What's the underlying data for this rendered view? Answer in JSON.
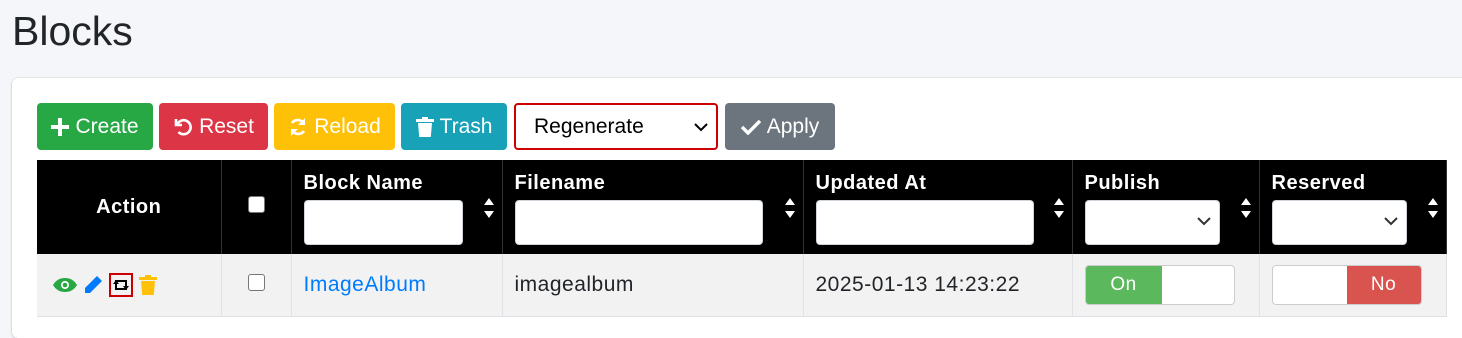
{
  "page": {
    "title": "Blocks"
  },
  "toolbar": {
    "create_label": "Create",
    "reset_label": "Reset",
    "reload_label": "Reload",
    "trash_label": "Trash",
    "bulk_action_value": "Regenerate",
    "apply_label": "Apply"
  },
  "table": {
    "columns": {
      "action": "Action",
      "block_name": "Block Name",
      "filename": "Filename",
      "updated_at": "Updated At",
      "publish": "Publish",
      "reserved": "Reserved"
    },
    "rows": [
      {
        "block_name": "ImageAlbum",
        "filename": "imagealbum",
        "updated_at": "2025-01-13 14:23:22",
        "publish": "On",
        "reserved": "No"
      }
    ]
  },
  "colors": {
    "create": "#28a745",
    "reset": "#dc3545",
    "reload": "#ffc107",
    "trash": "#17a2b8",
    "apply": "#6c757d",
    "on": "#5cb85c",
    "no": "#d9534f"
  }
}
